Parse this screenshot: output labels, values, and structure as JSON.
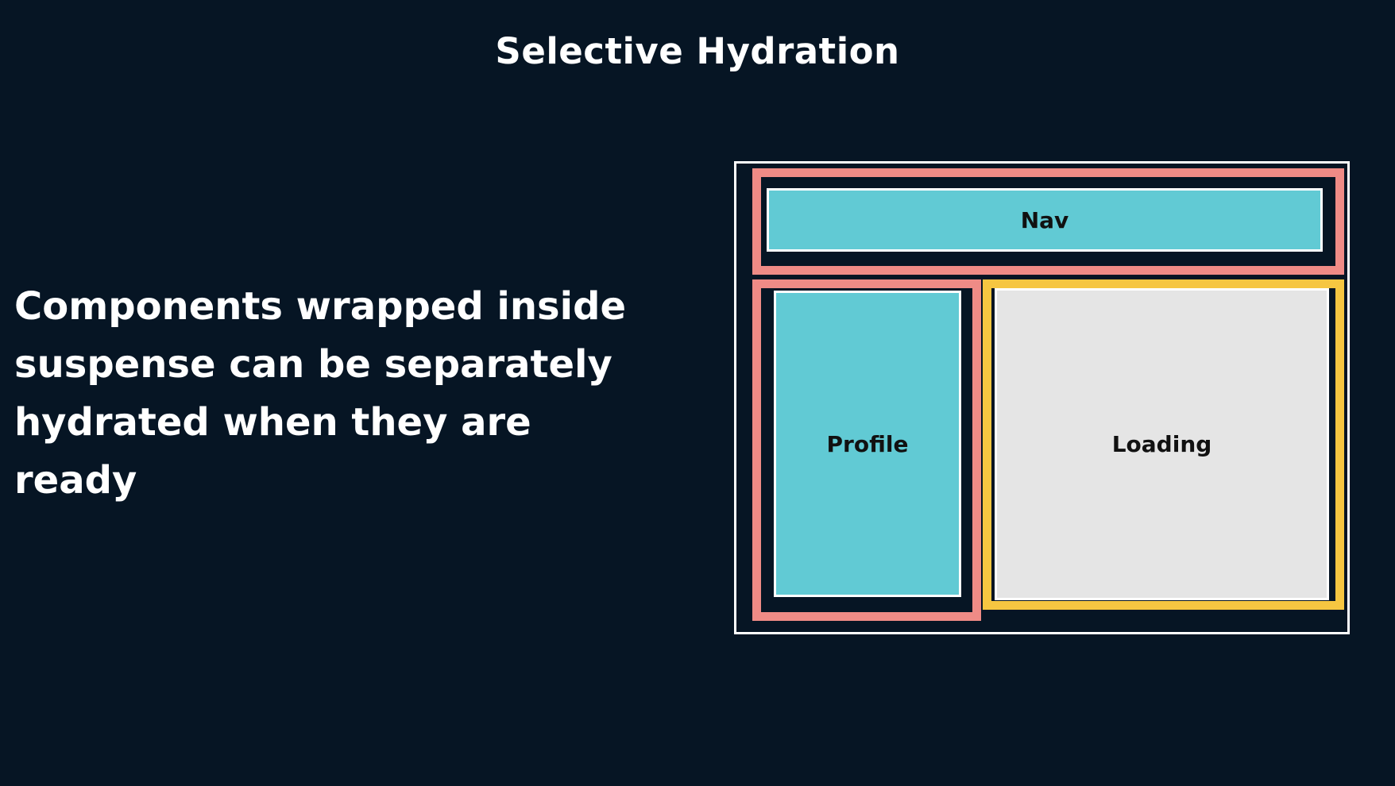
{
  "title": "Selective Hydration",
  "description": [
    "Components wrapped inside",
    "suspense can be separately",
    "hydrated when they are ready"
  ],
  "components": {
    "nav": "Nav",
    "profile": "Profile",
    "loading": "Loading"
  },
  "colors": {
    "background": "#061524",
    "suspense_boundary": "#ef8b86",
    "loading_boundary": "#f6c641",
    "hydrated_component": "#61cad4",
    "loading_component": "#e5e5e5"
  }
}
